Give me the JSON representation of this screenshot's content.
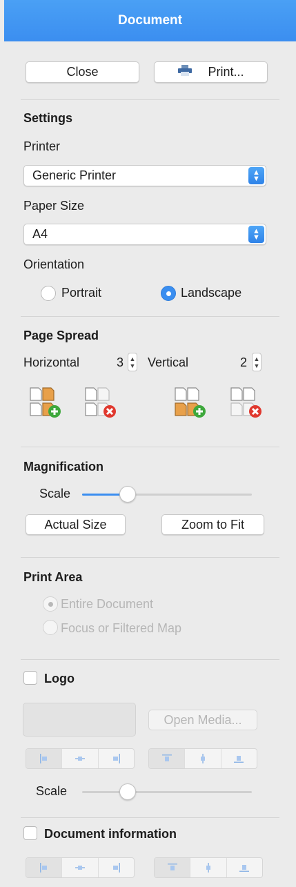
{
  "window": {
    "title": "Document"
  },
  "top_buttons": {
    "close": "Close",
    "print": "Print..."
  },
  "settings": {
    "heading": "Settings",
    "printer_label": "Printer",
    "printer_value": "Generic Printer",
    "paper_label": "Paper Size",
    "paper_value": "A4",
    "orientation_label": "Orientation",
    "portrait": "Portrait",
    "landscape": "Landscape",
    "orientation_selected": "Landscape"
  },
  "page_spread": {
    "heading": "Page Spread",
    "horizontal_label": "Horizontal",
    "horizontal_value": "3",
    "vertical_label": "Vertical",
    "vertical_value": "2",
    "icons": [
      "add-column-icon",
      "remove-column-icon",
      "add-row-icon",
      "remove-row-icon"
    ]
  },
  "magnification": {
    "heading": "Magnification",
    "scale_label": "Scale",
    "scale_fraction": 0.27,
    "actual_size": "Actual Size",
    "zoom_to_fit": "Zoom to Fit"
  },
  "print_area": {
    "heading": "Print Area",
    "entire_document": "Entire Document",
    "focus_filtered": "Focus or Filtered Map",
    "selected": "Entire Document"
  },
  "logo": {
    "label": "Logo",
    "open_media": "Open Media...",
    "scale_label": "Scale",
    "scale_fraction": 0.27,
    "align_horizontal_icons": [
      "align-left-icon",
      "align-center-horizontal-icon",
      "align-right-icon"
    ],
    "align_vertical_icons": [
      "align-top-icon",
      "align-center-vertical-icon",
      "align-bottom-icon"
    ]
  },
  "doc_info": {
    "label": "Document information"
  },
  "colors": {
    "accent": "#3a8ef0",
    "title_bar": "#4aa0f5",
    "icon_orange": "#e8a04a",
    "add_green": "#3ea83c",
    "remove_red": "#e0382e"
  }
}
